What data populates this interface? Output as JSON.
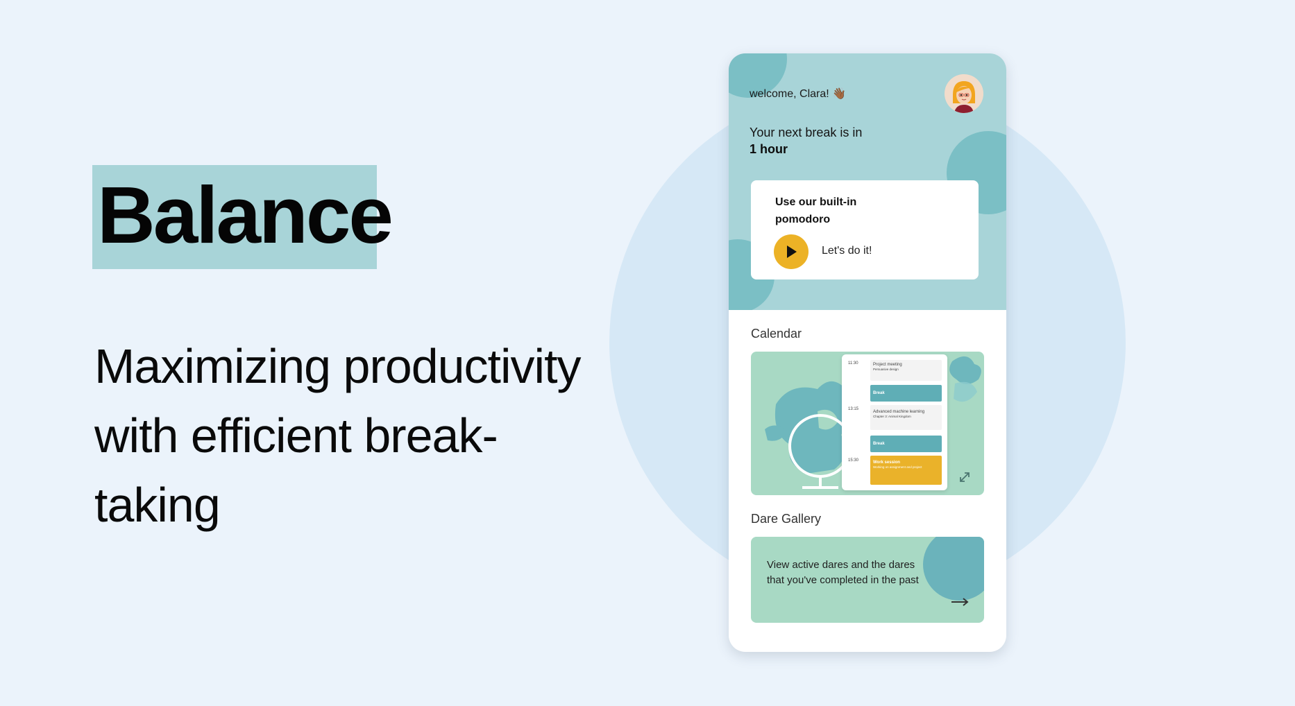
{
  "hero": {
    "brand": "Balance",
    "tagline": "Maximizing productivity with efficient break-taking"
  },
  "app": {
    "welcome": "welcome, Clara! 👋🏾",
    "next_break_label": "Your next break is in",
    "next_break_value": "1 hour",
    "pomodoro": {
      "title": "Use our built-in pomodoro",
      "action_label": "Let's do it!"
    },
    "calendar": {
      "label": "Calendar",
      "times": [
        "11:30",
        "13:15",
        "15:30"
      ],
      "events": [
        {
          "title": "Project meeting",
          "subtitle": "Persuasive design"
        },
        {
          "title": "Break",
          "subtitle": ""
        },
        {
          "title": "Advanced machine learning",
          "subtitle": "Chapter 3: Animal Kingdom"
        },
        {
          "title": "Break",
          "subtitle": ""
        },
        {
          "title": "Work session",
          "subtitle": "Working on assignment and project"
        }
      ]
    },
    "dare_gallery": {
      "label": "Dare Gallery",
      "description": "View active dares and the dares that you've completed in the past"
    }
  },
  "colors": {
    "background": "#ebf3fb",
    "accent_teal": "#a8d4d8",
    "accent_mint": "#a8d9c4",
    "accent_yellow": "#ecb226"
  },
  "icons": [
    "play-icon",
    "expand-icon",
    "arrow-right-icon",
    "avatar",
    "globe-illustration"
  ]
}
